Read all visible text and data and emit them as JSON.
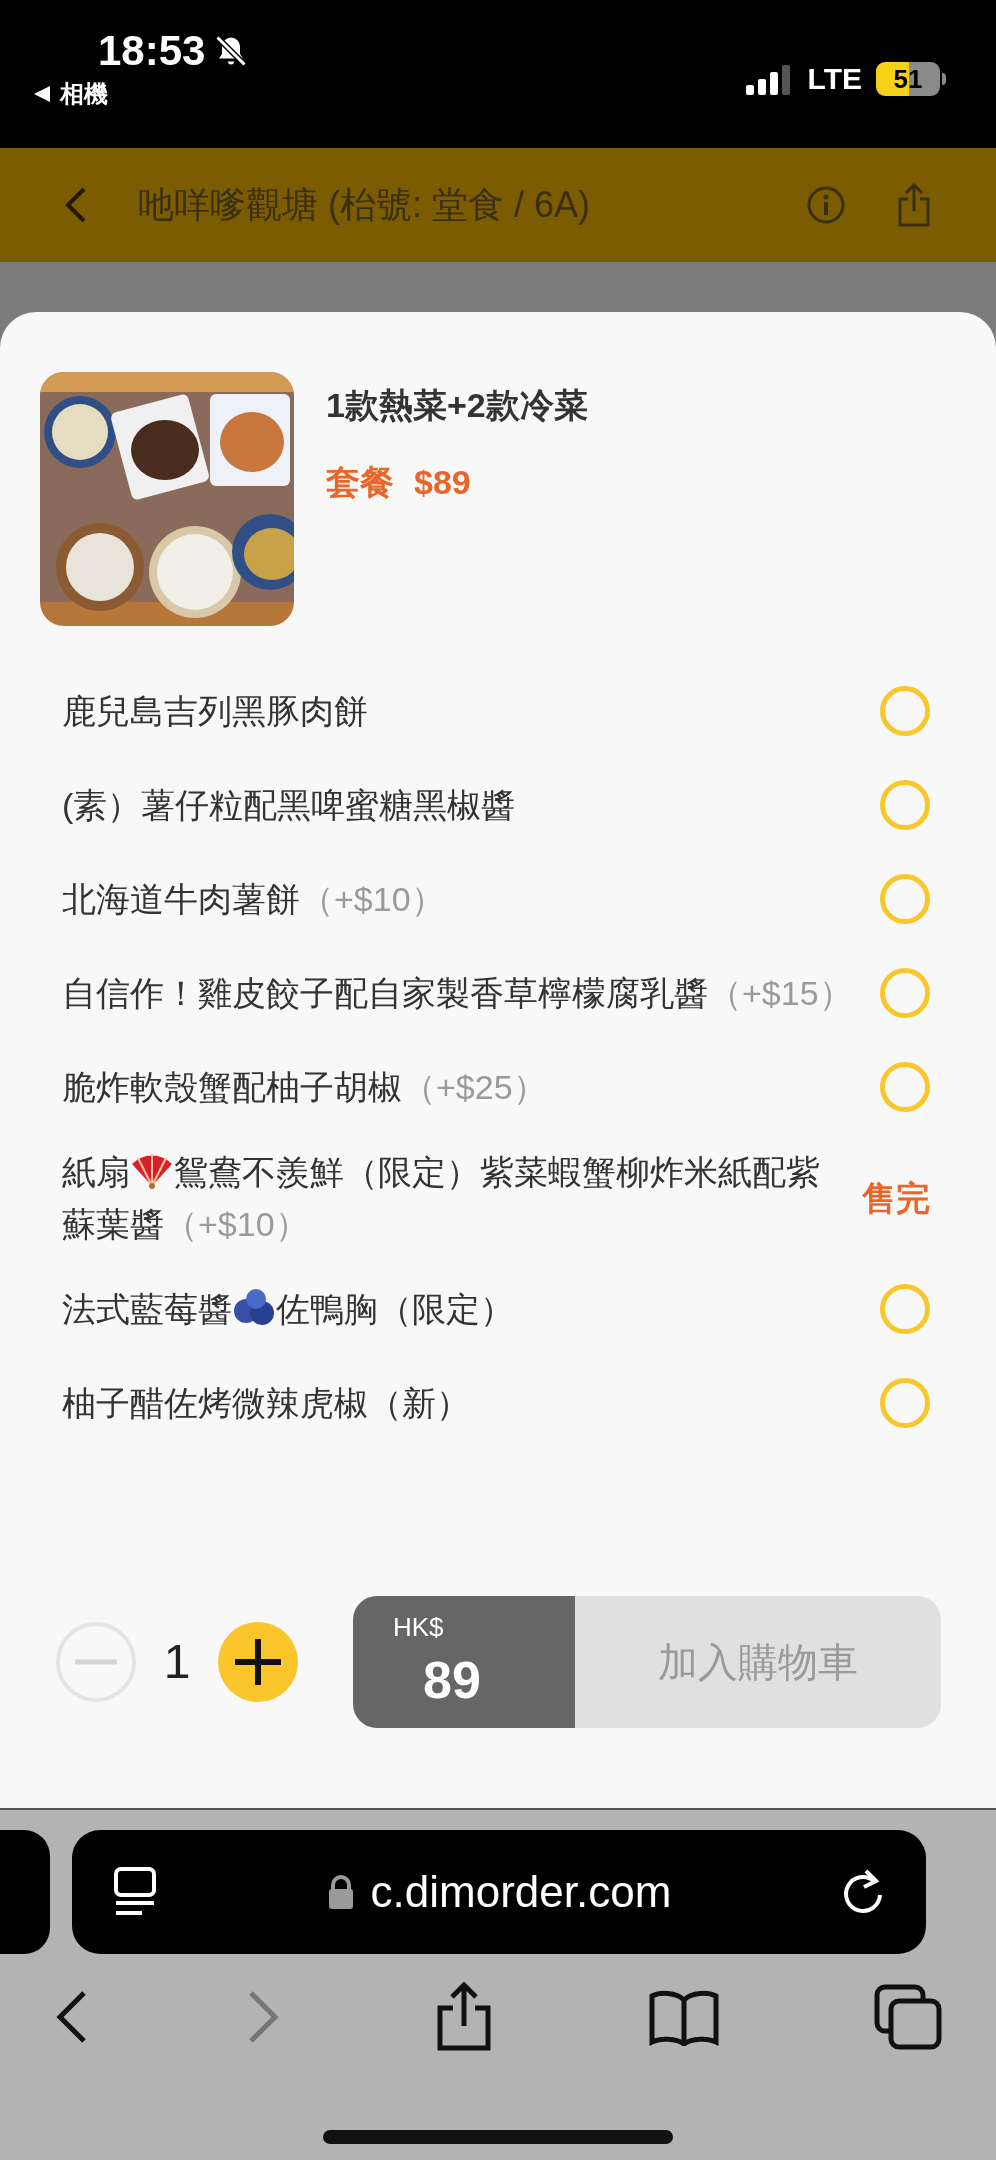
{
  "status_bar": {
    "time": "18:53",
    "back_app": "相機",
    "network": "LTE",
    "battery": "51"
  },
  "header": {
    "title": "吔咩嗲觀塘 (枱號: 堂食 / 6A)"
  },
  "product": {
    "kind": "picture",
    "name": "1款熱菜+2款冷菜",
    "price_label": "套餐",
    "price": "$89"
  },
  "options": [
    {
      "segments": [
        {
          "kind": "text",
          "text": "鹿兒島吉列黑豚肉餅"
        }
      ],
      "sold_out": false,
      "selected": false
    },
    {
      "segments": [
        {
          "kind": "text",
          "text": "(素）薯仔粒配黑啤蜜糖黑椒醬"
        }
      ],
      "sold_out": false,
      "selected": false
    },
    {
      "segments": [
        {
          "kind": "text",
          "text": "北海道牛肉薯餅"
        }
      ],
      "extra": "（+$10）",
      "sold_out": false,
      "selected": false
    },
    {
      "segments": [
        {
          "kind": "text",
          "text": "自信作！雞皮餃子配自家製香草檸檬腐乳醬"
        }
      ],
      "extra": "（+$15）",
      "sold_out": false,
      "selected": false
    },
    {
      "segments": [
        {
          "kind": "text",
          "text": "脆炸軟殼蟹配柚子胡椒"
        }
      ],
      "extra": "（+$25）",
      "sold_out": false,
      "selected": false
    },
    {
      "segments": [
        {
          "kind": "text",
          "text": "紙扇"
        },
        {
          "kind": "fan"
        },
        {
          "kind": "text",
          "text": "鴛鴦不羨鮮（限定）紫菜蝦蟹柳炸米紙配紫蘇葉醬"
        }
      ],
      "extra": "（+$10）",
      "sold_out": true,
      "sold_out_label": "售完"
    },
    {
      "segments": [
        {
          "kind": "text",
          "text": "法式藍莓醬"
        },
        {
          "kind": "berries"
        },
        {
          "kind": "text",
          "text": "佐鴨胸（限定）"
        }
      ],
      "sold_out": false,
      "selected": false
    },
    {
      "segments": [
        {
          "kind": "text",
          "text": "柚子醋佐烤微辣虎椒（新）"
        }
      ],
      "sold_out": false,
      "selected": false
    }
  ],
  "order": {
    "quantity": "1",
    "currency": "HK$",
    "total": "89",
    "add_button": {
      "label": "加入購物車",
      "disabled": true
    }
  },
  "browser": {
    "url": "c.dimorder.com"
  }
}
